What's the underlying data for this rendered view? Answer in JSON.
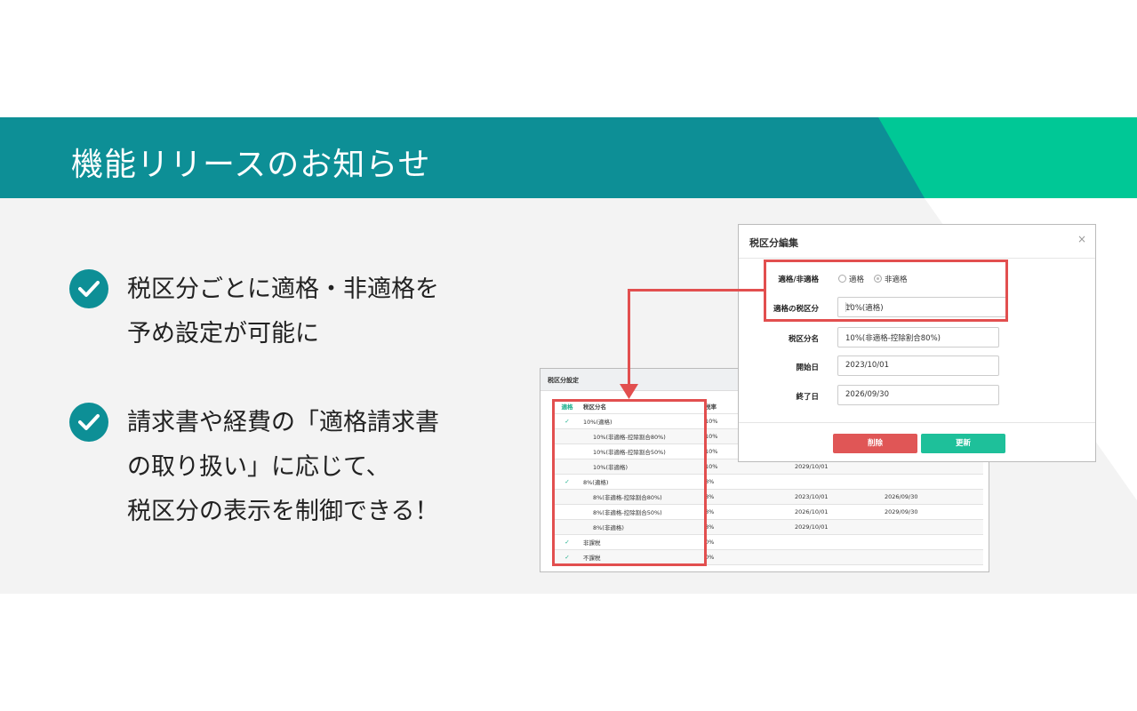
{
  "banner": {
    "title": "機能リリースのお知らせ"
  },
  "features": [
    {
      "lines": [
        "税区分ごとに適格・非適格を",
        "予め設定が可能に"
      ]
    },
    {
      "lines": [
        "請求書や経費の「適格請求書",
        "の取り扱い」に応じて、",
        "税区分の表示を制御できる！"
      ]
    }
  ],
  "table_panel": {
    "title": "税区分設定",
    "headers": [
      "適格",
      "税区分名",
      "税率",
      "",
      ""
    ],
    "rows": [
      {
        "check": "✓",
        "name": "10%(適格)",
        "rate": "10%",
        "start": "",
        "end": ""
      },
      {
        "check": "",
        "name": "10%(非適格-控除割合80%)",
        "rate": "10%",
        "start": "",
        "end": ""
      },
      {
        "check": "",
        "name": "10%(非適格-控除割合50%)",
        "rate": "10%",
        "start": "",
        "end": ""
      },
      {
        "check": "",
        "name": "10%(非適格)",
        "rate": "10%",
        "start": "2029/10/01",
        "end": ""
      },
      {
        "check": "✓",
        "name": "8%(適格)",
        "rate": "8%",
        "start": "",
        "end": ""
      },
      {
        "check": "",
        "name": "8%(非適格-控除割合80%)",
        "rate": "8%",
        "start": "2023/10/01",
        "end": "2026/09/30"
      },
      {
        "check": "",
        "name": "8%(非適格-控除割合50%)",
        "rate": "8%",
        "start": "2026/10/01",
        "end": "2029/09/30"
      },
      {
        "check": "",
        "name": "8%(非適格)",
        "rate": "8%",
        "start": "2029/10/01",
        "end": ""
      },
      {
        "check": "✓",
        "name": "非課税",
        "rate": "0%",
        "start": "",
        "end": ""
      },
      {
        "check": "✓",
        "name": "不課税",
        "rate": "0%",
        "start": "",
        "end": ""
      }
    ]
  },
  "modal": {
    "title": "税区分編集",
    "close": "×",
    "qualified_label": "適格/非適格",
    "radio_qualified": "適格",
    "radio_nonqualified": "非適格",
    "category_label": "適格の税区分",
    "category_value": "10%(適格)",
    "name_label": "税区分名",
    "name_value": "10%(非適格-控除割合80%)",
    "start_label": "開始日",
    "start_value": "2023/10/01",
    "end_label": "終了日",
    "end_value": "2026/09/30",
    "delete_label": "削除",
    "update_label": "更新"
  },
  "colors": {
    "teal": "#0d8f96",
    "green": "#00c896",
    "red": "#e24f4f",
    "delete": "#e05656",
    "update": "#1ec09a"
  }
}
